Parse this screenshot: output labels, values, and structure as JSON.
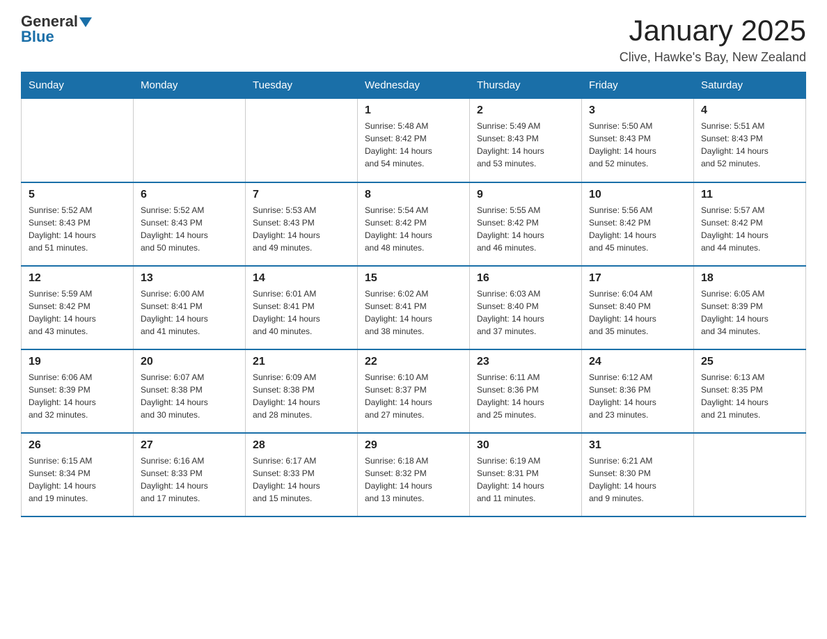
{
  "logo": {
    "general": "General",
    "blue": "Blue"
  },
  "header": {
    "month_year": "January 2025",
    "location": "Clive, Hawke's Bay, New Zealand"
  },
  "weekdays": [
    "Sunday",
    "Monday",
    "Tuesday",
    "Wednesday",
    "Thursday",
    "Friday",
    "Saturday"
  ],
  "weeks": [
    [
      {
        "day": "",
        "info": ""
      },
      {
        "day": "",
        "info": ""
      },
      {
        "day": "",
        "info": ""
      },
      {
        "day": "1",
        "info": "Sunrise: 5:48 AM\nSunset: 8:42 PM\nDaylight: 14 hours\nand 54 minutes."
      },
      {
        "day": "2",
        "info": "Sunrise: 5:49 AM\nSunset: 8:43 PM\nDaylight: 14 hours\nand 53 minutes."
      },
      {
        "day": "3",
        "info": "Sunrise: 5:50 AM\nSunset: 8:43 PM\nDaylight: 14 hours\nand 52 minutes."
      },
      {
        "day": "4",
        "info": "Sunrise: 5:51 AM\nSunset: 8:43 PM\nDaylight: 14 hours\nand 52 minutes."
      }
    ],
    [
      {
        "day": "5",
        "info": "Sunrise: 5:52 AM\nSunset: 8:43 PM\nDaylight: 14 hours\nand 51 minutes."
      },
      {
        "day": "6",
        "info": "Sunrise: 5:52 AM\nSunset: 8:43 PM\nDaylight: 14 hours\nand 50 minutes."
      },
      {
        "day": "7",
        "info": "Sunrise: 5:53 AM\nSunset: 8:43 PM\nDaylight: 14 hours\nand 49 minutes."
      },
      {
        "day": "8",
        "info": "Sunrise: 5:54 AM\nSunset: 8:42 PM\nDaylight: 14 hours\nand 48 minutes."
      },
      {
        "day": "9",
        "info": "Sunrise: 5:55 AM\nSunset: 8:42 PM\nDaylight: 14 hours\nand 46 minutes."
      },
      {
        "day": "10",
        "info": "Sunrise: 5:56 AM\nSunset: 8:42 PM\nDaylight: 14 hours\nand 45 minutes."
      },
      {
        "day": "11",
        "info": "Sunrise: 5:57 AM\nSunset: 8:42 PM\nDaylight: 14 hours\nand 44 minutes."
      }
    ],
    [
      {
        "day": "12",
        "info": "Sunrise: 5:59 AM\nSunset: 8:42 PM\nDaylight: 14 hours\nand 43 minutes."
      },
      {
        "day": "13",
        "info": "Sunrise: 6:00 AM\nSunset: 8:41 PM\nDaylight: 14 hours\nand 41 minutes."
      },
      {
        "day": "14",
        "info": "Sunrise: 6:01 AM\nSunset: 8:41 PM\nDaylight: 14 hours\nand 40 minutes."
      },
      {
        "day": "15",
        "info": "Sunrise: 6:02 AM\nSunset: 8:41 PM\nDaylight: 14 hours\nand 38 minutes."
      },
      {
        "day": "16",
        "info": "Sunrise: 6:03 AM\nSunset: 8:40 PM\nDaylight: 14 hours\nand 37 minutes."
      },
      {
        "day": "17",
        "info": "Sunrise: 6:04 AM\nSunset: 8:40 PM\nDaylight: 14 hours\nand 35 minutes."
      },
      {
        "day": "18",
        "info": "Sunrise: 6:05 AM\nSunset: 8:39 PM\nDaylight: 14 hours\nand 34 minutes."
      }
    ],
    [
      {
        "day": "19",
        "info": "Sunrise: 6:06 AM\nSunset: 8:39 PM\nDaylight: 14 hours\nand 32 minutes."
      },
      {
        "day": "20",
        "info": "Sunrise: 6:07 AM\nSunset: 8:38 PM\nDaylight: 14 hours\nand 30 minutes."
      },
      {
        "day": "21",
        "info": "Sunrise: 6:09 AM\nSunset: 8:38 PM\nDaylight: 14 hours\nand 28 minutes."
      },
      {
        "day": "22",
        "info": "Sunrise: 6:10 AM\nSunset: 8:37 PM\nDaylight: 14 hours\nand 27 minutes."
      },
      {
        "day": "23",
        "info": "Sunrise: 6:11 AM\nSunset: 8:36 PM\nDaylight: 14 hours\nand 25 minutes."
      },
      {
        "day": "24",
        "info": "Sunrise: 6:12 AM\nSunset: 8:36 PM\nDaylight: 14 hours\nand 23 minutes."
      },
      {
        "day": "25",
        "info": "Sunrise: 6:13 AM\nSunset: 8:35 PM\nDaylight: 14 hours\nand 21 minutes."
      }
    ],
    [
      {
        "day": "26",
        "info": "Sunrise: 6:15 AM\nSunset: 8:34 PM\nDaylight: 14 hours\nand 19 minutes."
      },
      {
        "day": "27",
        "info": "Sunrise: 6:16 AM\nSunset: 8:33 PM\nDaylight: 14 hours\nand 17 minutes."
      },
      {
        "day": "28",
        "info": "Sunrise: 6:17 AM\nSunset: 8:33 PM\nDaylight: 14 hours\nand 15 minutes."
      },
      {
        "day": "29",
        "info": "Sunrise: 6:18 AM\nSunset: 8:32 PM\nDaylight: 14 hours\nand 13 minutes."
      },
      {
        "day": "30",
        "info": "Sunrise: 6:19 AM\nSunset: 8:31 PM\nDaylight: 14 hours\nand 11 minutes."
      },
      {
        "day": "31",
        "info": "Sunrise: 6:21 AM\nSunset: 8:30 PM\nDaylight: 14 hours\nand 9 minutes."
      },
      {
        "day": "",
        "info": ""
      }
    ]
  ]
}
